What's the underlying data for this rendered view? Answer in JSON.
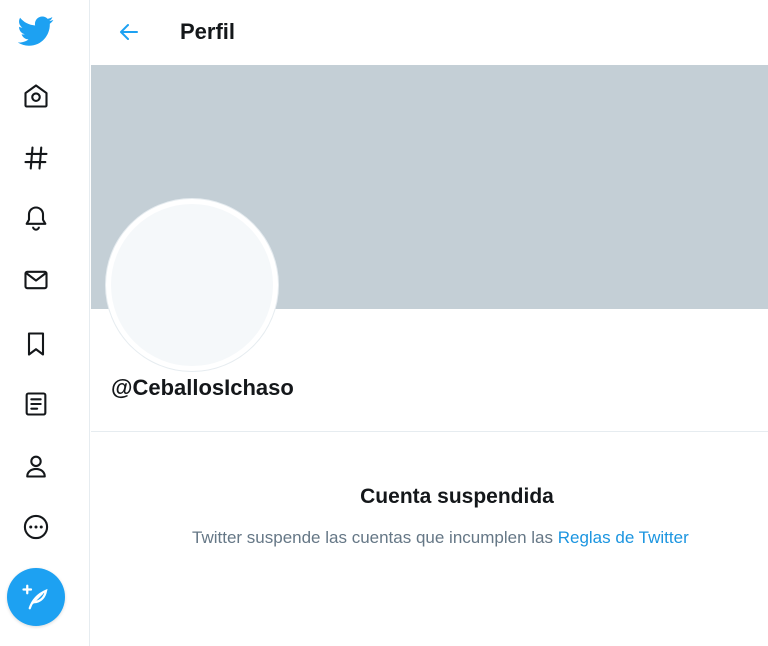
{
  "header": {
    "title": "Perfil"
  },
  "profile": {
    "handle": "@CeballosIchaso"
  },
  "suspension": {
    "title": "Cuenta suspendida",
    "message": "Twitter suspende las cuentas que incumplen las ",
    "rules_link": "Reglas de Twitter"
  },
  "icons": {
    "logo": "twitter-bird-icon",
    "back": "arrow-left-icon",
    "nav": [
      "home-icon",
      "hashtag-icon",
      "bell-icon",
      "mail-icon",
      "bookmark-icon",
      "list-icon",
      "person-icon",
      "more-icon"
    ],
    "compose": "feather-plus-icon"
  },
  "colors": {
    "accent": "#1da1f2",
    "banner": "#c4cfd6",
    "link": "#1b95e0",
    "secondary_text": "#657786"
  }
}
